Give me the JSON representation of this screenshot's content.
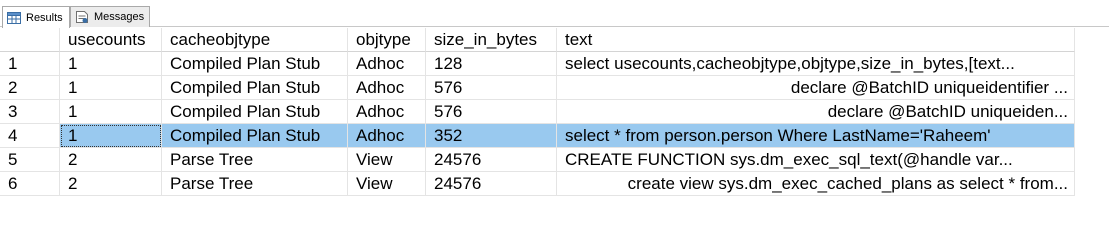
{
  "tabs": [
    {
      "label": "Results",
      "icon": "grid-icon",
      "active": true
    },
    {
      "label": "Messages",
      "icon": "messages-icon",
      "active": false
    }
  ],
  "columns": [
    "",
    "usecounts",
    "cacheobjtype",
    "objtype",
    "size_in_bytes",
    "text"
  ],
  "rows": [
    {
      "n": "1",
      "usecounts": "1",
      "cacheobjtype": "Compiled Plan Stub",
      "objtype": "Adhoc",
      "size_in_bytes": "128",
      "text": "select usecounts,cacheobjtype,objtype,size_in_bytes,[text...",
      "align": "left"
    },
    {
      "n": "2",
      "usecounts": "1",
      "cacheobjtype": "Compiled Plan Stub",
      "objtype": "Adhoc",
      "size_in_bytes": "576",
      "text": "declare @BatchID uniqueidentifier ...",
      "align": "right"
    },
    {
      "n": "3",
      "usecounts": "1",
      "cacheobjtype": "Compiled Plan Stub",
      "objtype": "Adhoc",
      "size_in_bytes": "576",
      "text": "declare @BatchID uniqueiden...",
      "align": "right"
    },
    {
      "n": "4",
      "usecounts": "1",
      "cacheobjtype": "Compiled Plan Stub",
      "objtype": "Adhoc",
      "size_in_bytes": "352",
      "text": "select * from person.person Where LastName='Raheem'",
      "align": "left"
    },
    {
      "n": "5",
      "usecounts": "2",
      "cacheobjtype": "Parse Tree",
      "objtype": "View",
      "size_in_bytes": "24576",
      "text": "CREATE FUNCTION sys.dm_exec_sql_text(@handle var...",
      "align": "left"
    },
    {
      "n": "6",
      "usecounts": "2",
      "cacheobjtype": "Parse Tree",
      "objtype": "View",
      "size_in_bytes": "24576",
      "text": "create view sys.dm_exec_cached_plans as select * from...",
      "align": "right"
    }
  ],
  "selected_row_index": 3,
  "colors": {
    "selection": "#99c9ef",
    "gridline": "#e4e4e4"
  }
}
